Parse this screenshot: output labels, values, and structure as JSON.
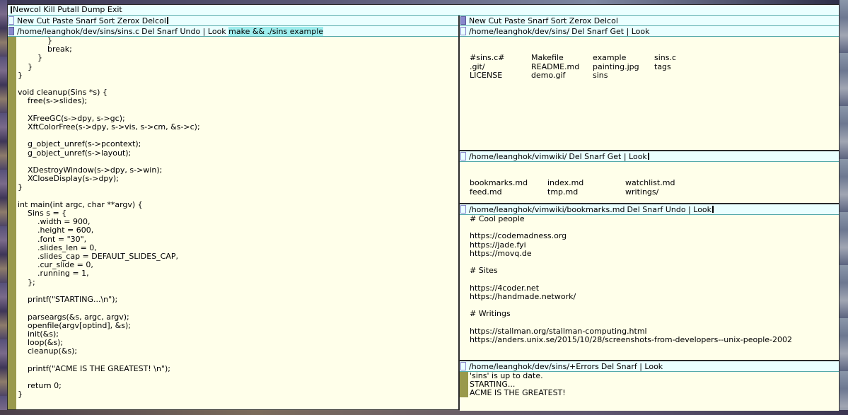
{
  "main_tag": {
    "commands": "Newcol Kill Putall Dump Exit"
  },
  "left_column": {
    "tag": "New Cut Paste Snarf Sort Zerox Delcol",
    "window": {
      "path": "/home/leanghok/dev/sins/sins.c",
      "commands": "Del Snarf Undo | Look",
      "selected": "make && ./sins example",
      "lines": [
        "            }",
        "            break;",
        "        }",
        "    }",
        "}",
        "",
        "void cleanup(Sins *s) {",
        "    free(s->slides);",
        "",
        "    XFreeGC(s->dpy, s->gc);",
        "    XftColorFree(s->dpy, s->vis, s->cm, &s->c);",
        "",
        "    g_object_unref(s->pcontext);",
        "    g_object_unref(s->layout);",
        "",
        "    XDestroyWindow(s->dpy, s->win);",
        "    XCloseDisplay(s->dpy);",
        "}",
        "",
        "int main(int argc, char **argv) {",
        "    Sins s = {",
        "        .width = 900,",
        "        .height = 600,",
        "        .font = \"30\",",
        "        .slides_len = 0,",
        "        .slides_cap = DEFAULT_SLIDES_CAP,",
        "        .cur_slide = 0,",
        "        .running = 1,",
        "    };",
        "",
        "    printf(\"STARTING...\\n\");",
        "",
        "    parseargs(&s, argc, argv);",
        "    openfile(argv[optind], &s);",
        "    init(&s);",
        "    loop(&s);",
        "    cleanup(&s);",
        "",
        "    printf(\"ACME IS THE GREATEST! \\n\");",
        "",
        "    return 0;",
        "}"
      ]
    }
  },
  "right_column": {
    "tag": "New Cut Paste Snarf Sort Zerox Delcol",
    "windows": [
      {
        "path": "/home/leanghok/dev/sins/",
        "commands": "Del Snarf Get | Look",
        "entries": [
          "#sins.c#",
          "Makefile",
          "example",
          "sins.c",
          ".git/",
          "README.md",
          "painting.jpg",
          "tags",
          "LICENSE",
          "demo.gif",
          "sins",
          ""
        ]
      },
      {
        "path": "/home/leanghok/vimwiki/",
        "commands": "Del Snarf Get | Look",
        "entries": [
          "bookmarks.md",
          "index.md",
          "watchlist.md",
          "feed.md",
          "tmp.md",
          "writings/"
        ]
      },
      {
        "path": "/home/leanghok/vimwiki/bookmarks.md",
        "commands": "Del Snarf Undo | Look",
        "lines": [
          "# Cool people",
          "",
          "https://codemadness.org",
          "https://jade.fyi",
          "https://movq.de",
          "",
          "# Sites",
          "",
          "https://4coder.net",
          "https://handmade.network/",
          "",
          "# Writings",
          "",
          "https://stallman.org/stallman-computing.html",
          "https://anders.unix.se/2015/10/28/screenshots-from-developers--unix-people-2002"
        ]
      },
      {
        "path": "/home/leanghok/dev/sins/+Errors",
        "commands": "Del Snarf | Look",
        "lines": [
          "'sins' is up to date.",
          "STARTING...",
          "ACME IS THE GREATEST!",
          ""
        ]
      }
    ]
  },
  "colors": {
    "body_bg": "#ffffea",
    "tag_bg": "#eaffff",
    "scrollbar": "#99994c",
    "selection": "#9eeeee",
    "column_box": "#8888cc"
  }
}
